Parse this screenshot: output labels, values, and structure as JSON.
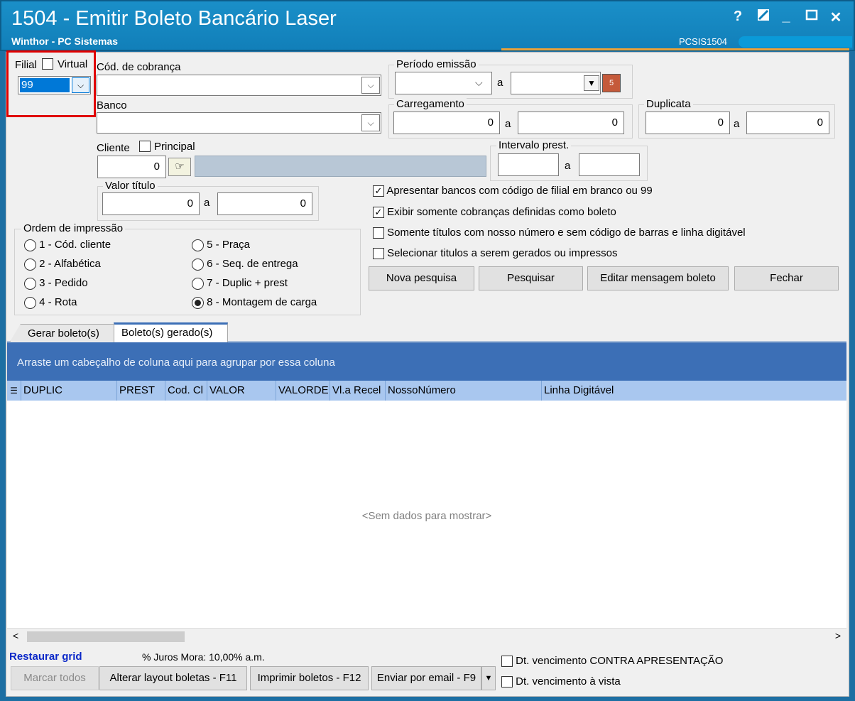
{
  "window": {
    "title": "1504 - Emitir Boleto Bancário Laser",
    "subtitle": "Winthor - PC Sistemas",
    "code": "PCSIS1504"
  },
  "filial": {
    "label": "Filial",
    "virtual_label": "Virtual",
    "value": "99"
  },
  "cod_cobranca": {
    "label": "Cód. de cobrança",
    "value": ""
  },
  "banco": {
    "label": "Banco",
    "value": ""
  },
  "periodo": {
    "label": "Período emissão",
    "sep": "a"
  },
  "carregamento": {
    "label": "Carregamento",
    "from": "0",
    "to": "0",
    "sep": "a"
  },
  "duplicata": {
    "label": "Duplicata",
    "from": "0",
    "to": "0",
    "sep": "a"
  },
  "cliente": {
    "label": "Cliente",
    "principal_label": "Principal",
    "value": "0"
  },
  "intervalo": {
    "label": "Intervalo prest.",
    "sep": "a"
  },
  "valor_titulo": {
    "label": "Valor título",
    "from": "0",
    "to": "0",
    "sep": "a"
  },
  "options": [
    {
      "label": "Apresentar bancos com código de filial em branco ou 99",
      "checked": true
    },
    {
      "label": "Exibir somente cobranças definidas como boleto",
      "checked": true
    },
    {
      "label": "Somente títulos com nosso número e sem código de barras e linha digitável",
      "checked": false
    },
    {
      "label": "Selecionar titulos a serem gerados ou impressos",
      "checked": false
    }
  ],
  "ordem": {
    "label": "Ordem de impressão",
    "items": [
      "1 - Cód. cliente",
      "2 - Alfabética",
      "3 - Pedido",
      "4 - Rota",
      "5 - Praça",
      "6 - Seq. de entrega",
      "7 - Duplic + prest",
      "8 - Montagem de carga"
    ],
    "selected": "8 - Montagem de carga"
  },
  "buttons": {
    "nova": "Nova pesquisa",
    "pesquisar": "Pesquisar",
    "editar": "Editar mensagem boleto",
    "fechar": "Fechar"
  },
  "tabs": [
    "Gerar boleto(s)",
    "Boleto(s) gerado(s)"
  ],
  "grid": {
    "group_hint": "Arraste um cabeçalho de coluna aqui para agrupar por essa coluna",
    "columns": [
      "DUPLIC",
      "PREST",
      "Cod. Cl",
      "VALOR",
      "VALORDE",
      "Vl.a Recel",
      "NossoNúmero",
      "Linha Digitável"
    ],
    "empty": "<Sem dados para mostrar>"
  },
  "footer": {
    "restaurar": "Restaurar grid",
    "juros": "% Juros Mora: 10,00% a.m.",
    "marcar": "Marcar todos",
    "alterar": "Alterar layout boletas - F11",
    "imprimir": "Imprimir boletos - F12",
    "enviar": "Enviar por email - F9",
    "dt_contra": "Dt. vencimento CONTRA APRESENTAÇÃO",
    "dt_vista": "Dt. vencimento à vista"
  },
  "colors": {
    "titlebar": "#117fb9",
    "group_panel": "#3c6fb6",
    "header": "#a9c7ef",
    "highlight": "#e00000"
  }
}
